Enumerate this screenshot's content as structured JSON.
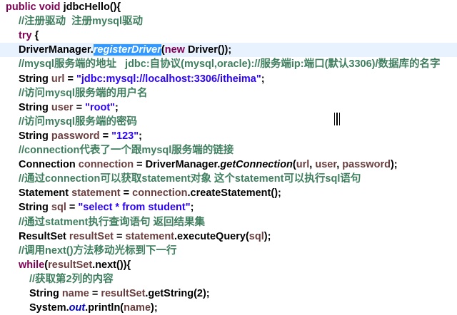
{
  "lines": [
    {
      "i": 0,
      "tokens": [
        {
          "t": "public ",
          "c": "kw"
        },
        {
          "t": "void ",
          "c": "kw"
        },
        {
          "t": "jdbcHello(){",
          "c": "pl"
        }
      ]
    },
    {
      "i": 1,
      "tokens": [
        {
          "t": "//注册驱动  注册mysql驱动",
          "c": "cm"
        }
      ]
    },
    {
      "i": 1,
      "tokens": [
        {
          "t": "try",
          "c": "kw"
        },
        {
          "t": " {",
          "c": "pl"
        }
      ]
    },
    {
      "i": 2,
      "current": true,
      "tokens": [
        {
          "t": "DriverManager.",
          "c": "pl"
        },
        {
          "t": "registerDriver",
          "c": "sel"
        },
        {
          "t": "(",
          "c": "pl"
        },
        {
          "t": "new ",
          "c": "kw"
        },
        {
          "t": "Driver());",
          "c": "pl"
        }
      ]
    },
    {
      "i": 2,
      "tokens": [
        {
          "t": "//mysql服务端的地址   jdbc:自协议(mysql,oracle)://服务端ip:端口(默认3306)/数据库的名字",
          "c": "cm"
        }
      ]
    },
    {
      "i": 2,
      "tokens": [
        {
          "t": "String ",
          "c": "pl"
        },
        {
          "t": "url",
          "c": "var"
        },
        {
          "t": " = ",
          "c": "pl"
        },
        {
          "t": "\"jdbc:mysql://localhost:3306/itheima\"",
          "c": "str"
        },
        {
          "t": ";",
          "c": "pl"
        }
      ]
    },
    {
      "i": 2,
      "tokens": [
        {
          "t": "//访问mysql服务端的用户名",
          "c": "cm"
        }
      ]
    },
    {
      "i": 2,
      "tokens": [
        {
          "t": "String ",
          "c": "pl"
        },
        {
          "t": "user",
          "c": "var"
        },
        {
          "t": " = ",
          "c": "pl"
        },
        {
          "t": "\"root\"",
          "c": "str"
        },
        {
          "t": ";",
          "c": "pl"
        }
      ]
    },
    {
      "i": 2,
      "tokens": [
        {
          "t": "//访问mysql服务端的密码",
          "c": "cm"
        }
      ]
    },
    {
      "i": 2,
      "tokens": [
        {
          "t": "String ",
          "c": "pl"
        },
        {
          "t": "password",
          "c": "var"
        },
        {
          "t": " = ",
          "c": "pl"
        },
        {
          "t": "\"123\"",
          "c": "str"
        },
        {
          "t": ";",
          "c": "pl"
        }
      ]
    },
    {
      "i": 2,
      "tokens": [
        {
          "t": "//connection代表了一个跟mysql服务端的链接",
          "c": "cm"
        }
      ]
    },
    {
      "i": 2,
      "tokens": [
        {
          "t": "Connection ",
          "c": "pl"
        },
        {
          "t": "connection",
          "c": "var"
        },
        {
          "t": " = DriverManager.",
          "c": "pl"
        },
        {
          "t": "getConnection",
          "c": "it"
        },
        {
          "t": "(",
          "c": "pl"
        },
        {
          "t": "url",
          "c": "var"
        },
        {
          "t": ", ",
          "c": "pl"
        },
        {
          "t": "user",
          "c": "var"
        },
        {
          "t": ", ",
          "c": "pl"
        },
        {
          "t": "password",
          "c": "var"
        },
        {
          "t": ");",
          "c": "pl"
        }
      ]
    },
    {
      "i": 2,
      "tokens": [
        {
          "t": "//通过connection可以获取statement对象 这个statement可以执行sql语句",
          "c": "cm"
        }
      ]
    },
    {
      "i": 2,
      "tokens": [
        {
          "t": "Statement ",
          "c": "pl"
        },
        {
          "t": "statement",
          "c": "var"
        },
        {
          "t": " = ",
          "c": "pl"
        },
        {
          "t": "connection",
          "c": "var"
        },
        {
          "t": ".createStatement();",
          "c": "pl"
        }
      ]
    },
    {
      "i": 2,
      "tokens": [
        {
          "t": "String ",
          "c": "pl"
        },
        {
          "t": "sql",
          "c": "var"
        },
        {
          "t": " = ",
          "c": "pl"
        },
        {
          "t": "\"select * from student\"",
          "c": "str"
        },
        {
          "t": ";",
          "c": "pl"
        }
      ]
    },
    {
      "i": 2,
      "tokens": [
        {
          "t": "//通过statment执行查询语句 返回结果集",
          "c": "cm"
        }
      ]
    },
    {
      "i": 2,
      "tokens": [
        {
          "t": "ResultSet ",
          "c": "pl"
        },
        {
          "t": "resultSet",
          "c": "var"
        },
        {
          "t": " = ",
          "c": "pl"
        },
        {
          "t": "statement",
          "c": "var"
        },
        {
          "t": ".executeQuery(",
          "c": "pl"
        },
        {
          "t": "sql",
          "c": "var"
        },
        {
          "t": ");",
          "c": "pl"
        }
      ]
    },
    {
      "i": 2,
      "tokens": [
        {
          "t": "//调用next()方法移动光标到下一行",
          "c": "cm"
        }
      ]
    },
    {
      "i": 2,
      "tokens": [
        {
          "t": "while",
          "c": "kw"
        },
        {
          "t": "(",
          "c": "pl"
        },
        {
          "t": "resultSet",
          "c": "var"
        },
        {
          "t": ".next()){",
          "c": "pl"
        }
      ]
    },
    {
      "i": 3,
      "tokens": [
        {
          "t": "//获取第2列的内容",
          "c": "cm"
        }
      ]
    },
    {
      "i": 3,
      "tokens": [
        {
          "t": "String ",
          "c": "pl"
        },
        {
          "t": "name",
          "c": "var"
        },
        {
          "t": " = ",
          "c": "pl"
        },
        {
          "t": "resultSet",
          "c": "var"
        },
        {
          "t": ".getString(2);",
          "c": "pl"
        }
      ]
    },
    {
      "i": 3,
      "tokens": [
        {
          "t": "System.",
          "c": "pl"
        },
        {
          "t": "out",
          "c": "fld"
        },
        {
          "t": ".println(",
          "c": "pl"
        },
        {
          "t": "name",
          "c": "var"
        },
        {
          "t": ");",
          "c": "pl"
        }
      ]
    }
  ]
}
